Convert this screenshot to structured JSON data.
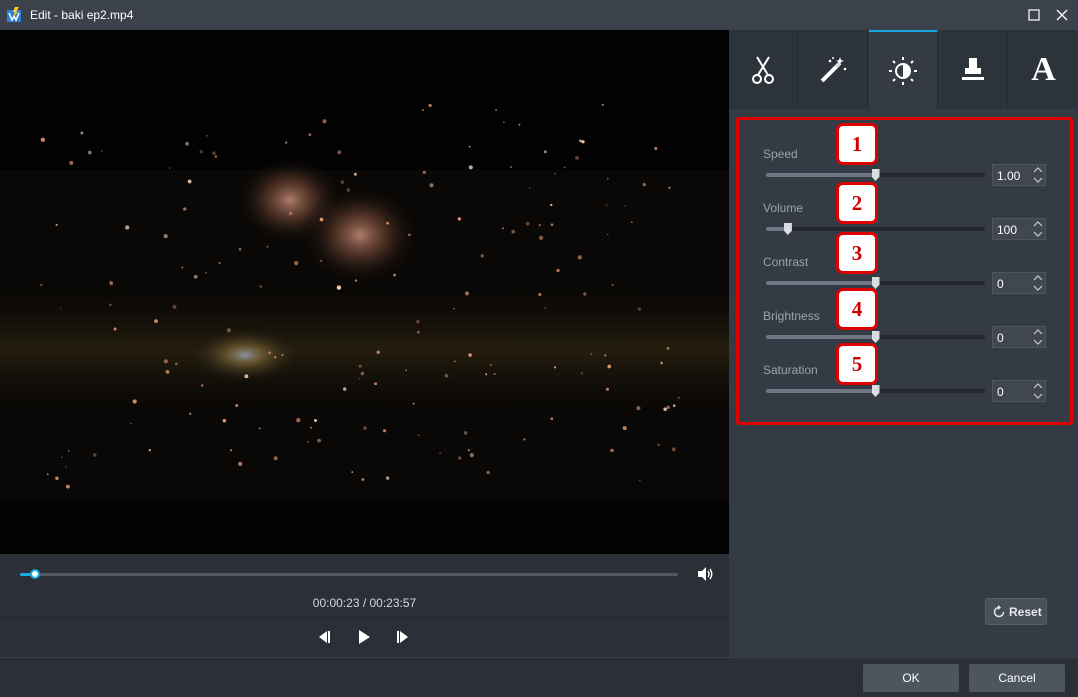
{
  "window": {
    "title": "Edit - baki ep2.mp4"
  },
  "icons": {
    "app": "video-edit-app-icon",
    "maximize": "maximize-icon",
    "close": "close-icon",
    "volume": "speaker-icon",
    "prev_frame": "previous-frame-icon",
    "play": "play-icon",
    "next_frame": "next-frame-icon",
    "reset": "refresh-icon"
  },
  "player": {
    "timecode": "00:00:23 / 00:23:57",
    "progress": 0.016
  },
  "tabs": [
    {
      "id": "trim",
      "icon": "scissors-icon",
      "active": false
    },
    {
      "id": "effects",
      "icon": "magic-wand-icon",
      "active": false
    },
    {
      "id": "adjust",
      "icon": "brightness-contrast-icon",
      "active": true
    },
    {
      "id": "watermark",
      "icon": "stamp-icon",
      "active": false
    },
    {
      "id": "text",
      "icon": "text-icon",
      "label": "A",
      "active": false
    }
  ],
  "adjustments": [
    {
      "label": "Speed",
      "value": "1.00",
      "level": 0.5,
      "badge": "1"
    },
    {
      "label": "Volume",
      "value": "100",
      "level": 0.1,
      "badge": "2"
    },
    {
      "label": "Contrast",
      "value": "0",
      "level": 0.5,
      "badge": "3"
    },
    {
      "label": "Brightness",
      "value": "0",
      "level": 0.5,
      "badge": "4"
    },
    {
      "label": "Saturation",
      "value": "0",
      "level": 0.5,
      "badge": "5"
    }
  ],
  "reset_label": "Reset",
  "buttons": {
    "ok": "OK",
    "cancel": "Cancel"
  },
  "colors": {
    "accent": "#19a8e0",
    "annotation": "#e00000"
  }
}
